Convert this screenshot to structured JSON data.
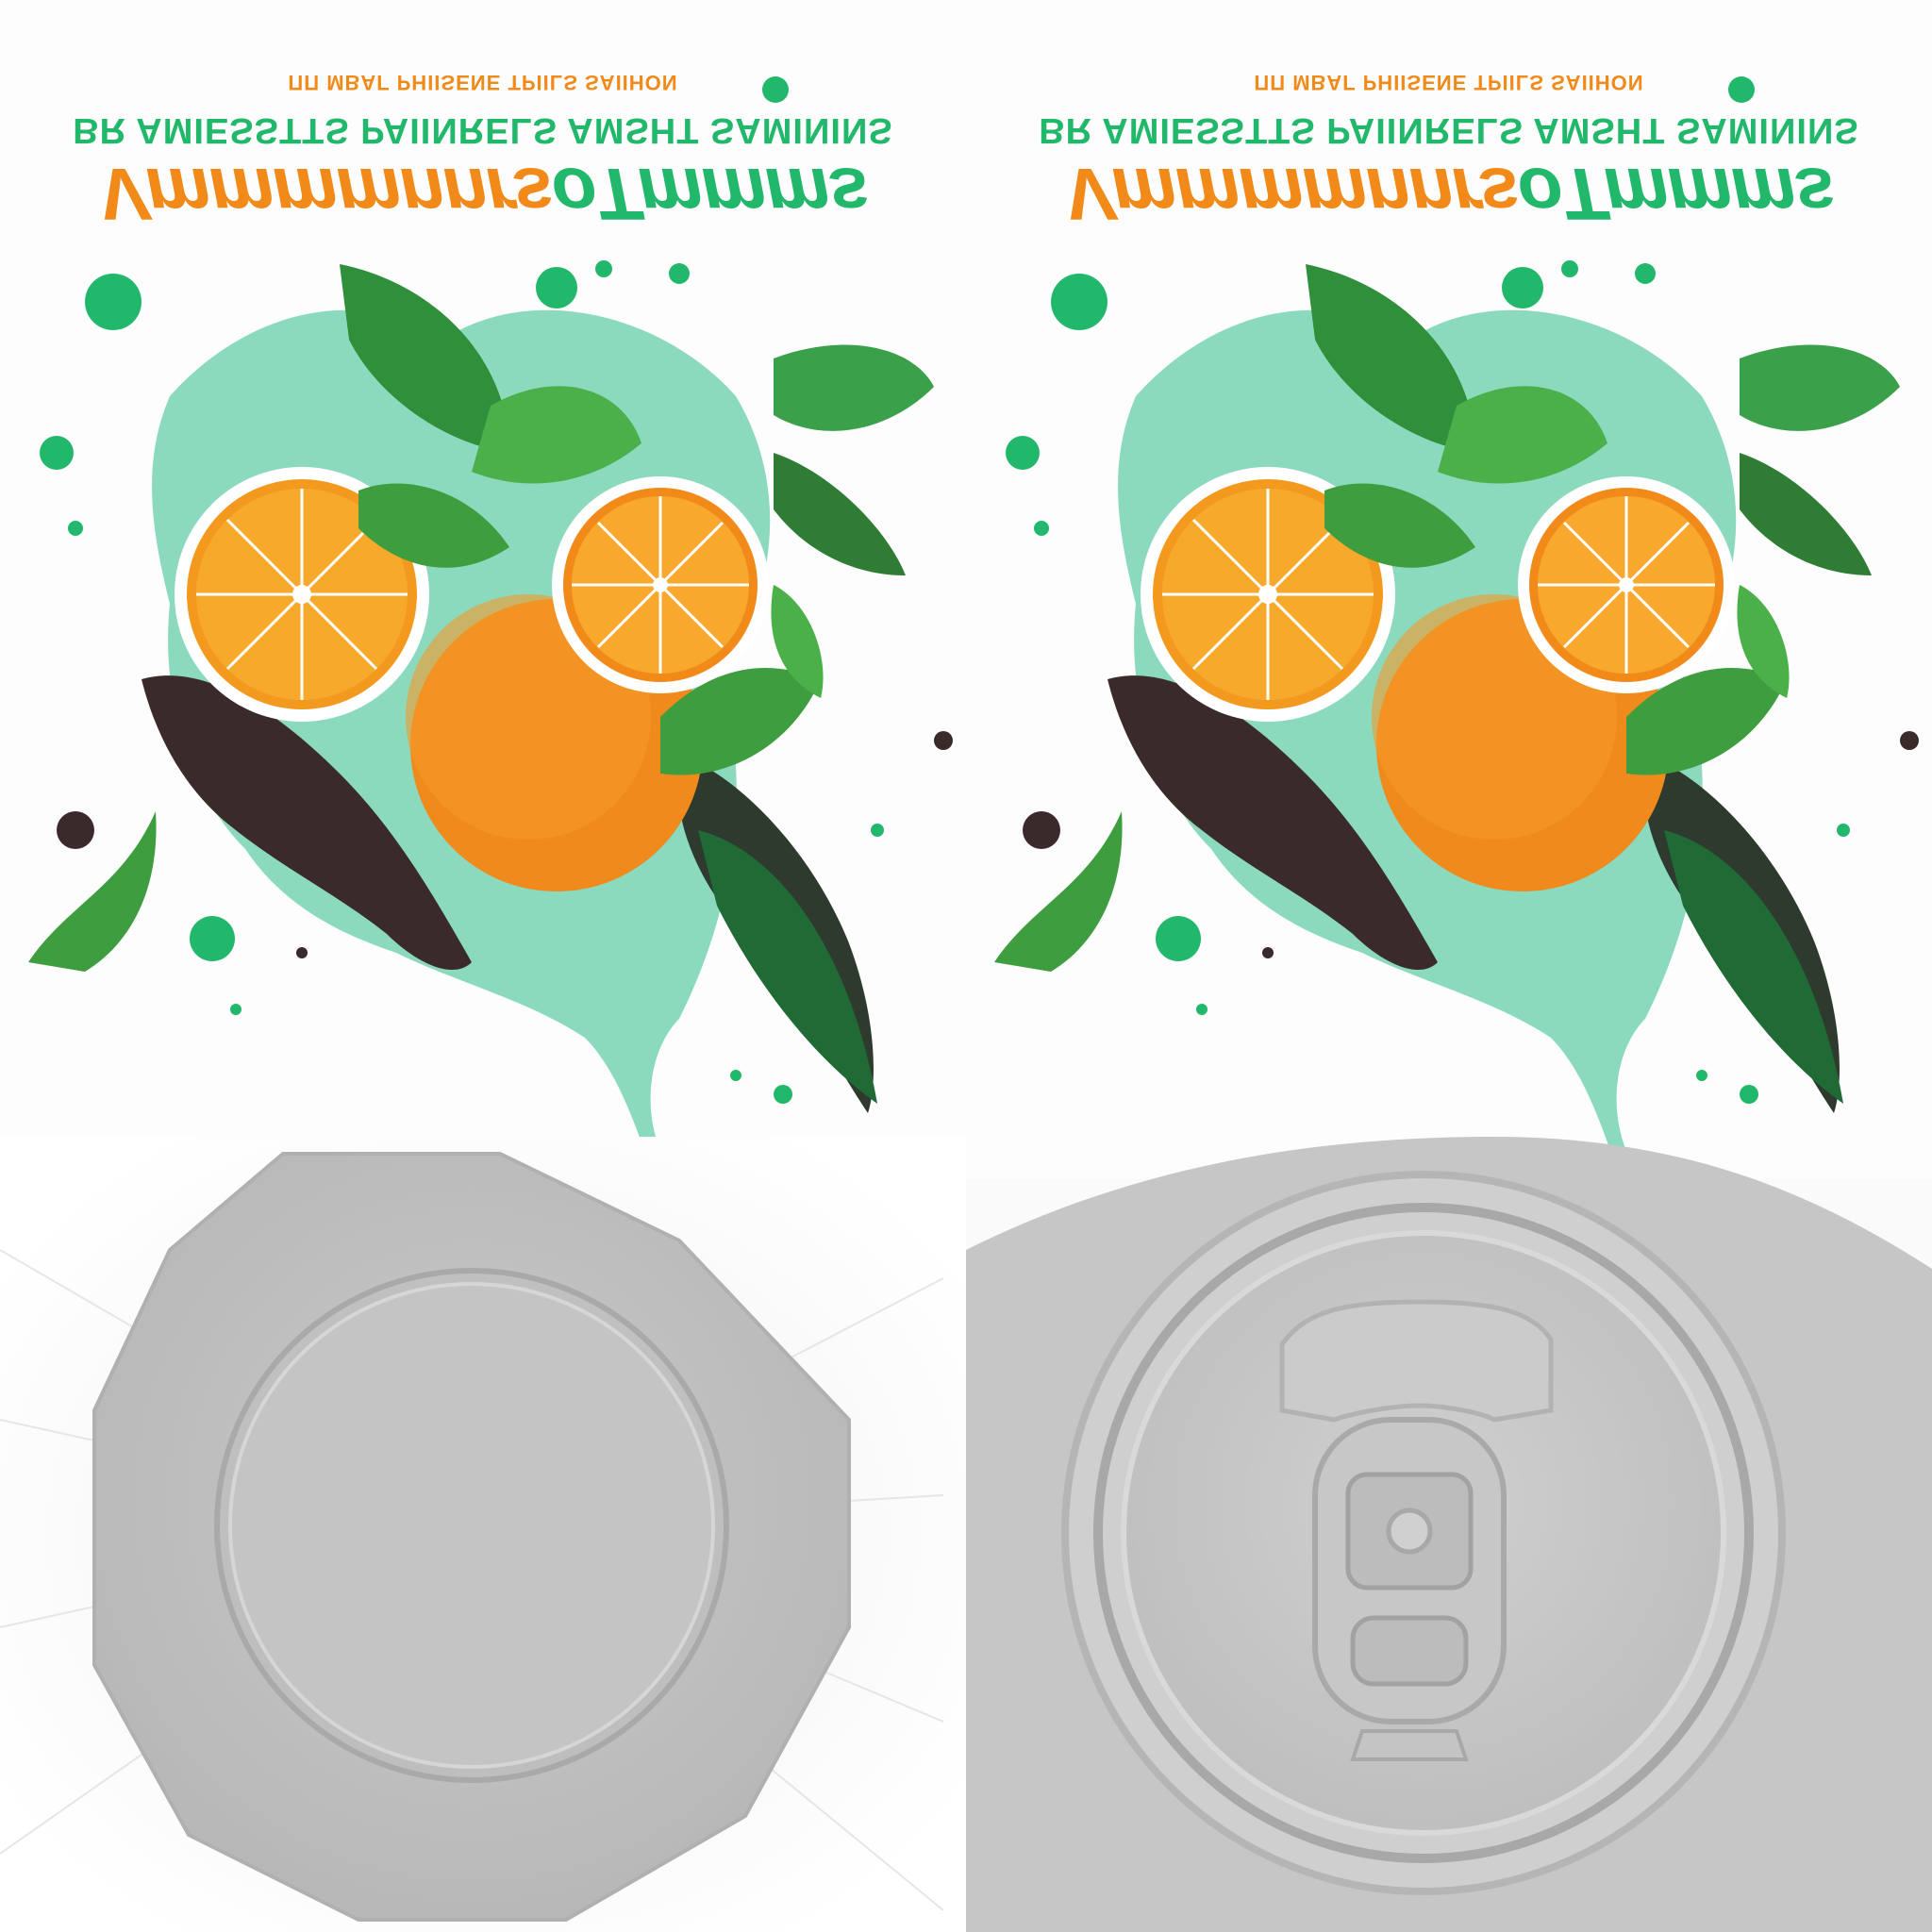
{
  "texture": {
    "panels": [
      {
        "line_small": "ΠΠ ΜΒΑΓ ΡΗΙΙSΕΝΕ ΤΡΙΙLS SΑΙΙΗΟΝ",
        "line_mid": "BR AMIESSTTS PAIINRELS AMSHT SAMININS",
        "brand_a": "Vmmmmnnrs",
        "brand_b": "oTmmms"
      },
      {
        "line_small": "ΠΠ ΜΒΑΓ ΡΗΙΙSΕΝΕ ΤΡΙΙLS SΑΙΙΗΟΝ",
        "line_mid": "BR AMIESSTTS PAIINRELS AMSHT SAMININS",
        "brand_a": "Vmmmmnnrs",
        "brand_b": "oTmmms"
      }
    ],
    "colors": {
      "orange": "#f28a1a",
      "green": "#22b86b",
      "mint": "#2dbd8a",
      "leaf": "#3a9a3a",
      "dark_splash": "#3b2a2a",
      "metal": "#c6c6c6"
    },
    "caps": [
      "can-bottom",
      "can-top-pull-tab"
    ]
  }
}
